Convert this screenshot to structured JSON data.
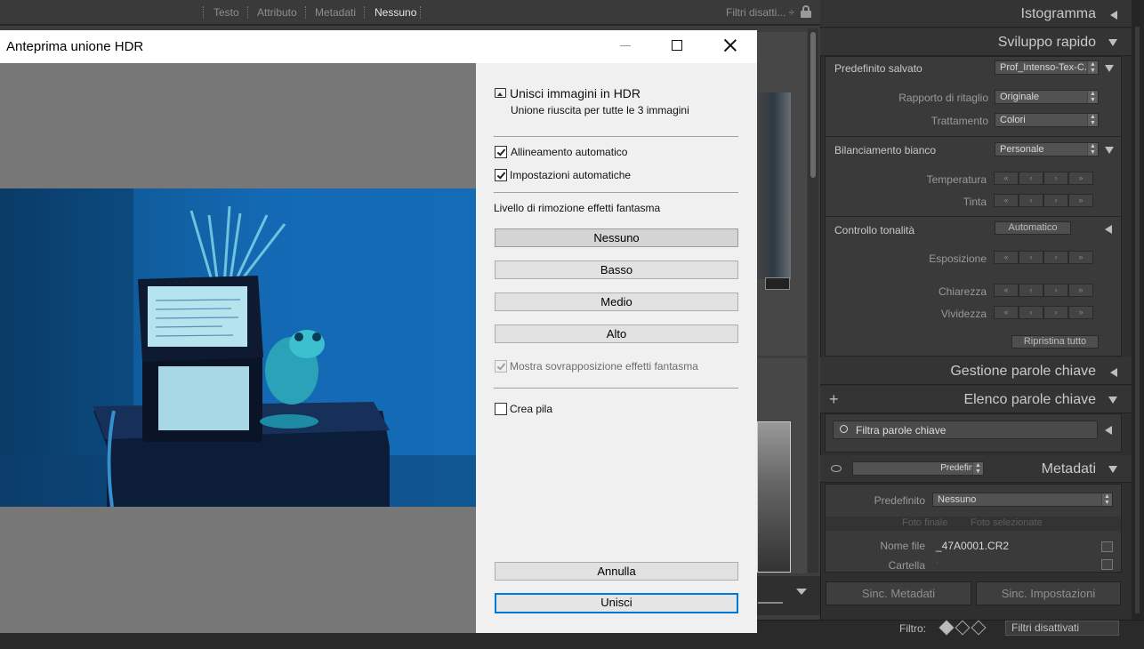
{
  "filter_bar": {
    "tabs": [
      "Testo",
      "Attributo",
      "Metadati",
      "Nessuno"
    ],
    "active_tab": "Nessuno",
    "filters_dropdown": "Filtri disatti... ÷",
    "lock_icon": "lock-icon"
  },
  "dialog": {
    "title": "Anteprima unione HDR",
    "heading": "Unisci immagini in HDR",
    "status": "Unione riuscita per tutte le 3 immagini",
    "auto_align": {
      "label": "Allineamento automatico",
      "checked": true
    },
    "auto_settings": {
      "label": "Impostazioni automatiche",
      "checked": true
    },
    "deghost_label": "Livello di rimozione effetti fantasma",
    "deghost_options": [
      "Nessuno",
      "Basso",
      "Medio",
      "Alto"
    ],
    "deghost_selected": "Nessuno",
    "show_overlay": {
      "label": "Mostra sovrapposizione effetti fantasma",
      "checked": true,
      "disabled": true
    },
    "create_stack": {
      "label": "Crea pila",
      "checked": false
    },
    "cancel_label": "Annulla",
    "merge_label": "Unisci"
  },
  "right_panel": {
    "histogram": "Istogramma",
    "quick_develop": {
      "title": "Sviluppo rapido",
      "saved_preset_label": "Predefinito salvato",
      "saved_preset_value": "Prof_Intenso-Tex-C...",
      "crop_ratio_label": "Rapporto di ritaglio",
      "crop_ratio_value": "Originale",
      "treatment_label": "Trattamento",
      "treatment_value": "Colori",
      "white_balance_label": "Bilanciamento bianco",
      "white_balance_value": "Personale",
      "temperature_label": "Temperatura",
      "tint_label": "Tinta",
      "tone_control_label": "Controllo tonalità",
      "auto_button": "Automatico",
      "exposure_label": "Esposizione",
      "clarity_label": "Chiarezza",
      "vibrance_label": "Vividezza",
      "reset_all": "Ripristina tutto",
      "stepper_glyphs": [
        "«",
        "‹",
        "›",
        "»"
      ]
    },
    "keywording": "Gestione parole chiave",
    "keyword_list": {
      "title": "Elenco parole chiave",
      "add": "+",
      "filter_placeholder": "Filtra parole chiave"
    },
    "metadata": {
      "title": "Metadati",
      "preset_select": "Predefinito",
      "preset_label": "Predefinito",
      "preset_value": "Nessuno",
      "tab_target": "Foto finale",
      "tab_selected": "Foto selezionate",
      "filename_label": "Nome file",
      "filename_value": "_47A0001.CR2",
      "folder_label": "Cartella",
      "folder_value": "ʼ"
    },
    "sync_metadata": "Sinc. Metadati",
    "sync_settings": "Sinc. Impostazioni"
  },
  "filmstrip": {
    "filter_label": "Filtro:",
    "filter_value": "Filtri disattivati"
  },
  "colors": {
    "accent": "#0078d7",
    "photo_blue": "#1369b3"
  }
}
